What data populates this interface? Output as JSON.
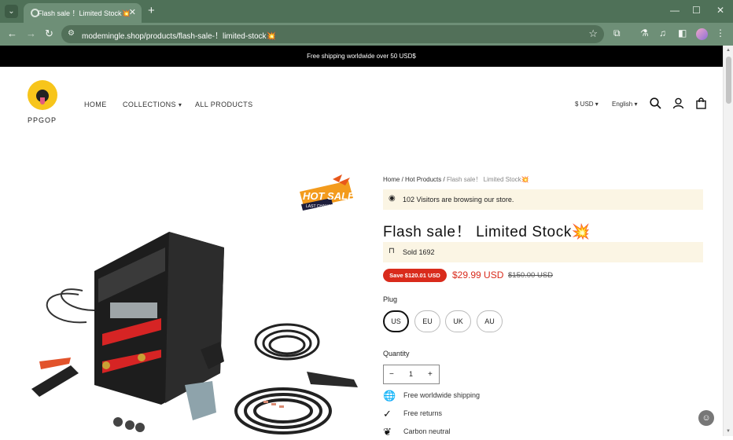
{
  "browser": {
    "tab_title": "Flash sale ！Limited Stock💥",
    "new_tab": "+",
    "close": "✕",
    "url": "modemingle.shop/products/flash-sale-！limited-stock💥",
    "win_min": "—",
    "win_max": "☐",
    "win_close": "✕"
  },
  "announcement": "Free shipping worldwide over 50 USD$",
  "header": {
    "logo_text": "PPGOP",
    "nav": [
      "HOME",
      "COLLECTIONS",
      "ALL PRODUCTS"
    ],
    "collections_chevron": "⌄",
    "currency": "$ USD",
    "language": "English"
  },
  "breadcrumb": {
    "home": "Home",
    "hot": "Hot Products",
    "current": "Flash sale！ Limited Stock💥",
    "sep": " / "
  },
  "visitors_text": "102 Visitors are browsing our store.",
  "product": {
    "title": "Flash sale！ Limited Stock💥",
    "sold_text": "Sold 1692",
    "save_badge": "Save $120.01 USD",
    "price": "$29.99 USD",
    "old_price": "$150.00 USD"
  },
  "plug": {
    "label": "Plug",
    "options": [
      "US",
      "EU",
      "UK",
      "AU"
    ],
    "selected": "US"
  },
  "quantity": {
    "label": "Quantity",
    "value": "1",
    "minus": "−",
    "plus": "+"
  },
  "features": [
    "Free worldwide shipping",
    "Free returns",
    "Carbon neutral"
  ],
  "hot_sale": {
    "title": "HOT SALE",
    "subtitle": "LAST CHANCE"
  },
  "colors": {
    "accent": "#d92b1c",
    "chrome": "#6e8f77",
    "notice_bg": "#fbf5e4",
    "logo": "#f7c51b"
  }
}
